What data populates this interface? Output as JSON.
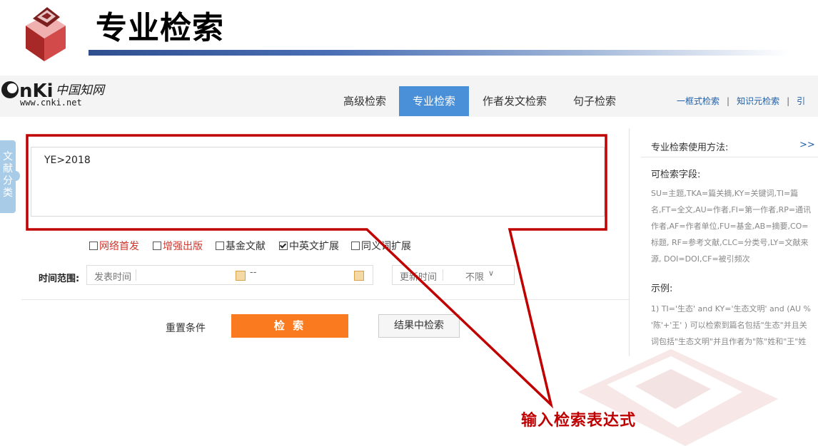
{
  "slide": {
    "title": "专业检索",
    "annotation": "输入检索表达式",
    "accent_color": "#c00000"
  },
  "cnki": {
    "logo_text": "CNKi中国知网",
    "logo_url_text": "www.cnki.net",
    "tabs": [
      {
        "label": "高级检索",
        "active": false
      },
      {
        "label": "专业检索",
        "active": true
      },
      {
        "label": "作者发文检索",
        "active": false
      },
      {
        "label": "句子检索",
        "active": false
      }
    ],
    "right_links": [
      "一框式检索",
      "知识元检索",
      "引"
    ]
  },
  "side_tab": {
    "label": "文献分类"
  },
  "query": {
    "value": "YE>2018"
  },
  "checkboxes": [
    {
      "label": "网络首发",
      "checked": false,
      "color": "#d0362d"
    },
    {
      "label": "增强出版",
      "checked": false,
      "color": "#d0362d"
    },
    {
      "label": "基金文献",
      "checked": false
    },
    {
      "label": "中英文扩展",
      "checked": true
    },
    {
      "label": "同义词扩展",
      "checked": false
    }
  ],
  "time": {
    "label": "时间范围:",
    "publish_placeholder": "发表时间",
    "separator": "--",
    "update_placeholder": "更新时间",
    "update_value": "不限"
  },
  "buttons": {
    "reset": "重置条件",
    "search": "检 索",
    "search_in_results": "结果中检索",
    "search_color": "#f97a1f"
  },
  "help": {
    "title": "专业检索使用方法:",
    "more": ">>",
    "fields_title": "可检索字段:",
    "fields_lines": [
      "SU=主题,TKA=篇关摘,KY=关键词,TI=篇",
      "名,FT=全文,AU=作者,FI=第一作者,RP=通讯",
      "作者,AF=作者单位,FU=基金,AB=摘要,CO=",
      "标题, RF=参考文献,CLC=分类号,LY=文献来",
      "源, DOI=DOI,CF=被引频次"
    ],
    "example_title": "示例:",
    "example_lines": [
      "1) TI='生态' and KY='生态文明' and (AU %",
      "'陈'+'王' ) 可以检索到篇名包括\"生态\"并且关",
      "词包括\"生态文明\"并且作者为\"陈\"姓和\"王\"姓"
    ]
  }
}
